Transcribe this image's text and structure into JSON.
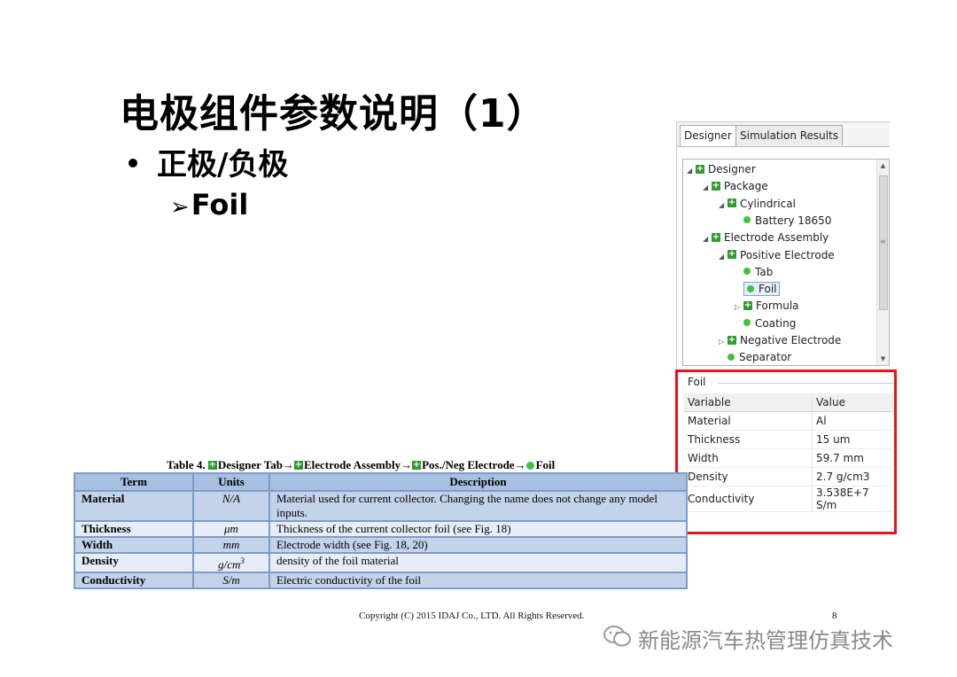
{
  "slide": {
    "title": "电极组件参数说明（1）",
    "bullet1": "正极/负极",
    "bullet2": "Foil",
    "bullet2_marker": "➢"
  },
  "panel": {
    "tabs": [
      "Designer",
      "Simulation Results"
    ],
    "tree": [
      {
        "label": "Designer",
        "type": "group",
        "level": 0,
        "expander": "expanded"
      },
      {
        "label": "Package",
        "type": "group",
        "level": 1,
        "expander": "expanded"
      },
      {
        "label": "Cylindrical",
        "type": "group",
        "level": 2,
        "expander": "expanded"
      },
      {
        "label": "Battery 18650",
        "type": "leaf",
        "level": 3
      },
      {
        "label": "Electrode Assembly",
        "type": "group",
        "level": 1,
        "expander": "expanded"
      },
      {
        "label": "Positive Electrode",
        "type": "group",
        "level": 2,
        "expander": "expanded"
      },
      {
        "label": "Tab",
        "type": "leaf",
        "level": 3
      },
      {
        "label": "Foil",
        "type": "leaf",
        "level": 3,
        "selected": true
      },
      {
        "label": "Formula",
        "type": "group",
        "level": 3,
        "expander": "collapsed"
      },
      {
        "label": "Coating",
        "type": "leaf",
        "level": 3
      },
      {
        "label": "Negative Electrode",
        "type": "group",
        "level": 2,
        "expander": "collapsed"
      },
      {
        "label": "Separator",
        "type": "leaf",
        "level": 2
      }
    ],
    "foil": {
      "legend": "Foil",
      "headers": [
        "Variable",
        "Value"
      ],
      "rows": [
        [
          "Material",
          "Al"
        ],
        [
          "Thickness",
          "15 um"
        ],
        [
          "Width",
          "59.7 mm"
        ],
        [
          "Density",
          "2.7 g/cm3"
        ],
        [
          "Conductivity",
          "3.538E+7 S/m"
        ]
      ]
    }
  },
  "doc_table": {
    "caption_parts": [
      "Table 4. ",
      "Designer Tab",
      "→",
      "Electrode Assembly",
      "→",
      "Pos./Neg Electrode",
      "→",
      "Foil"
    ],
    "headers": [
      "Term",
      "Units",
      "Description"
    ],
    "rows": [
      [
        "Material",
        "N/A",
        "Material used for current collector. Changing the name does not change any model inputs."
      ],
      [
        "Thickness",
        "μm",
        "Thickness of the current collector foil  (see Fig. 18)"
      ],
      [
        "Width",
        "mm",
        "Electrode width (see Fig. 18, 20)"
      ],
      [
        "Density",
        "g/cm3",
        "density of the foil material"
      ],
      [
        "Conductivity",
        "S/m",
        "Electric conductivity of the foil"
      ]
    ]
  },
  "footer": {
    "copyright": "Copyright (C) 2015 IDAJ Co., LTD. All Rights Reserved.",
    "page": "8"
  },
  "watermark": "新能源汽车热管理仿真技术",
  "colors": {
    "highlight_box": "#e8141c",
    "tree_group_icon": "#2f9b2f",
    "tree_leaf_icon": "#3fc23f",
    "table_header": "#a7bfe0",
    "table_cell": "#c3d3ea"
  }
}
